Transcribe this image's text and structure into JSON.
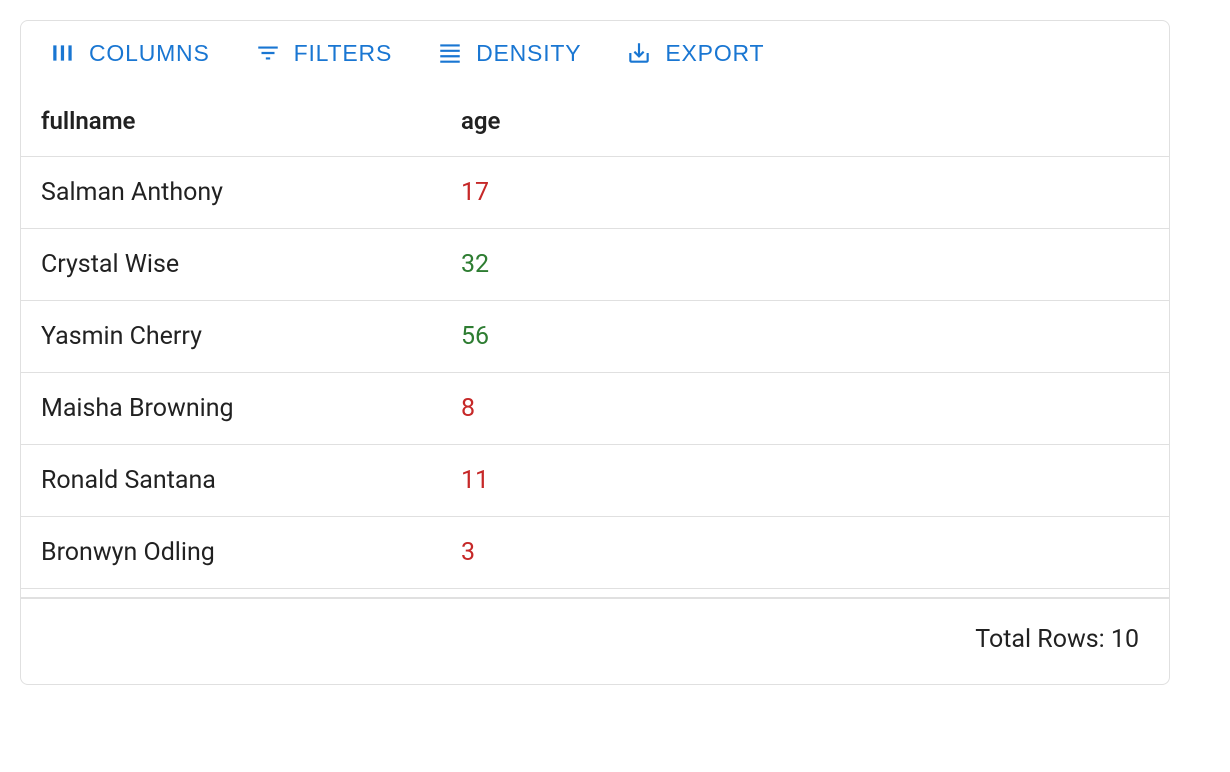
{
  "toolbar": {
    "columns_label": "COLUMNS",
    "filters_label": "FILTERS",
    "density_label": "DENSITY",
    "export_label": "EXPORT"
  },
  "headers": {
    "fullname": "fullname",
    "age": "age"
  },
  "rows": [
    {
      "fullname": "Salman Anthony",
      "age": "17",
      "age_class": "age-red"
    },
    {
      "fullname": "Crystal Wise",
      "age": "32",
      "age_class": "age-green"
    },
    {
      "fullname": "Yasmin Cherry",
      "age": "56",
      "age_class": "age-green"
    },
    {
      "fullname": "Maisha Browning",
      "age": "8",
      "age_class": "age-red"
    },
    {
      "fullname": "Ronald Santana",
      "age": "11",
      "age_class": "age-red"
    },
    {
      "fullname": "Bronwyn Odling",
      "age": "3",
      "age_class": "age-red"
    }
  ],
  "footer": {
    "total_label": "Total Rows: 10"
  },
  "colors": {
    "primary": "#1976d2",
    "age_low": "#c62828",
    "age_high": "#2e7d32"
  }
}
